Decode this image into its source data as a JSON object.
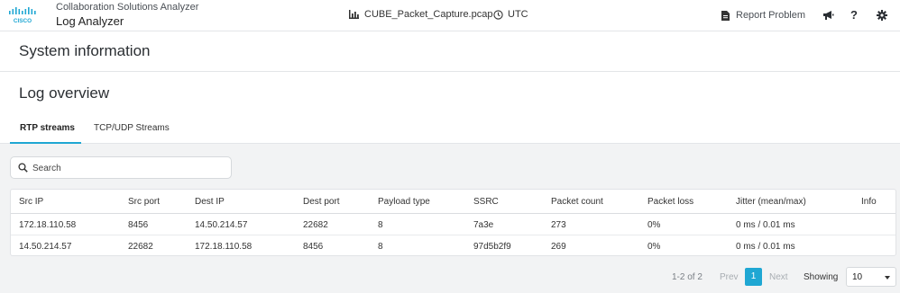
{
  "header": {
    "brand_text": "CISCO",
    "app_name": "Collaboration Solutions Analyzer",
    "app_subtitle": "Log Analyzer",
    "file_name": "CUBE_Packet_Capture.pcap",
    "timezone": "UTC",
    "report_label": "Report Problem",
    "icons": [
      "bar-chart-icon",
      "clock-icon",
      "document-icon",
      "megaphone-icon",
      "help-icon",
      "gear-icon"
    ]
  },
  "system_info": {
    "title": "System information"
  },
  "overview": {
    "title": "Log overview",
    "tabs": [
      {
        "label": "RTP streams",
        "active": true
      },
      {
        "label": "TCP/UDP Streams",
        "active": false
      }
    ]
  },
  "search": {
    "placeholder": "Search",
    "value": ""
  },
  "table": {
    "columns": [
      "Src IP",
      "Src port",
      "Dest IP",
      "Dest port",
      "Payload type",
      "SSRC",
      "Packet count",
      "Packet loss",
      "Jitter (mean/max)",
      "Info"
    ],
    "rows": [
      [
        "172.18.110.58",
        "8456",
        "14.50.214.57",
        "22682",
        "8",
        "7a3e",
        "273",
        "0%",
        "0 ms / 0.01 ms",
        ""
      ],
      [
        "14.50.214.57",
        "22682",
        "172.18.110.58",
        "8456",
        "8",
        "97d5b2f9",
        "269",
        "0%",
        "0 ms / 0.01 ms",
        ""
      ]
    ]
  },
  "pagination": {
    "range": "1-2 of 2",
    "prev_label": "Prev",
    "current_page": "1",
    "next_label": "Next",
    "showing_label": "Showing",
    "page_size": "10"
  },
  "colors": {
    "accent": "#1fa7d3",
    "panel_bg": "#f2f3f4",
    "border": "#e3e5e8"
  }
}
